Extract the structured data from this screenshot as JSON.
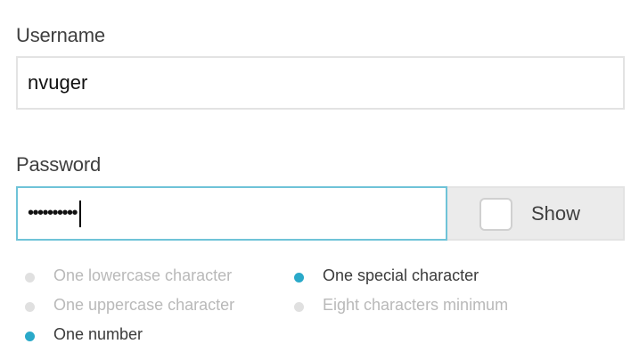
{
  "username": {
    "label": "Username",
    "value": "nvuger"
  },
  "password": {
    "label": "Password",
    "masked_value": "••••••••••",
    "show_label": "Show",
    "show_checked": false
  },
  "requirements": [
    {
      "text": "One lowercase character",
      "met": false
    },
    {
      "text": "One uppercase character",
      "met": false
    },
    {
      "text": "One number",
      "met": true
    },
    {
      "text": "One special character",
      "met": true
    },
    {
      "text": "Eight characters minimum",
      "met": false
    }
  ],
  "colors": {
    "accent": "#2aa9c9",
    "focus_border": "#6fc3d8",
    "unmet_text": "#b9b9b9",
    "unmet_dot": "#e0e0e0"
  }
}
